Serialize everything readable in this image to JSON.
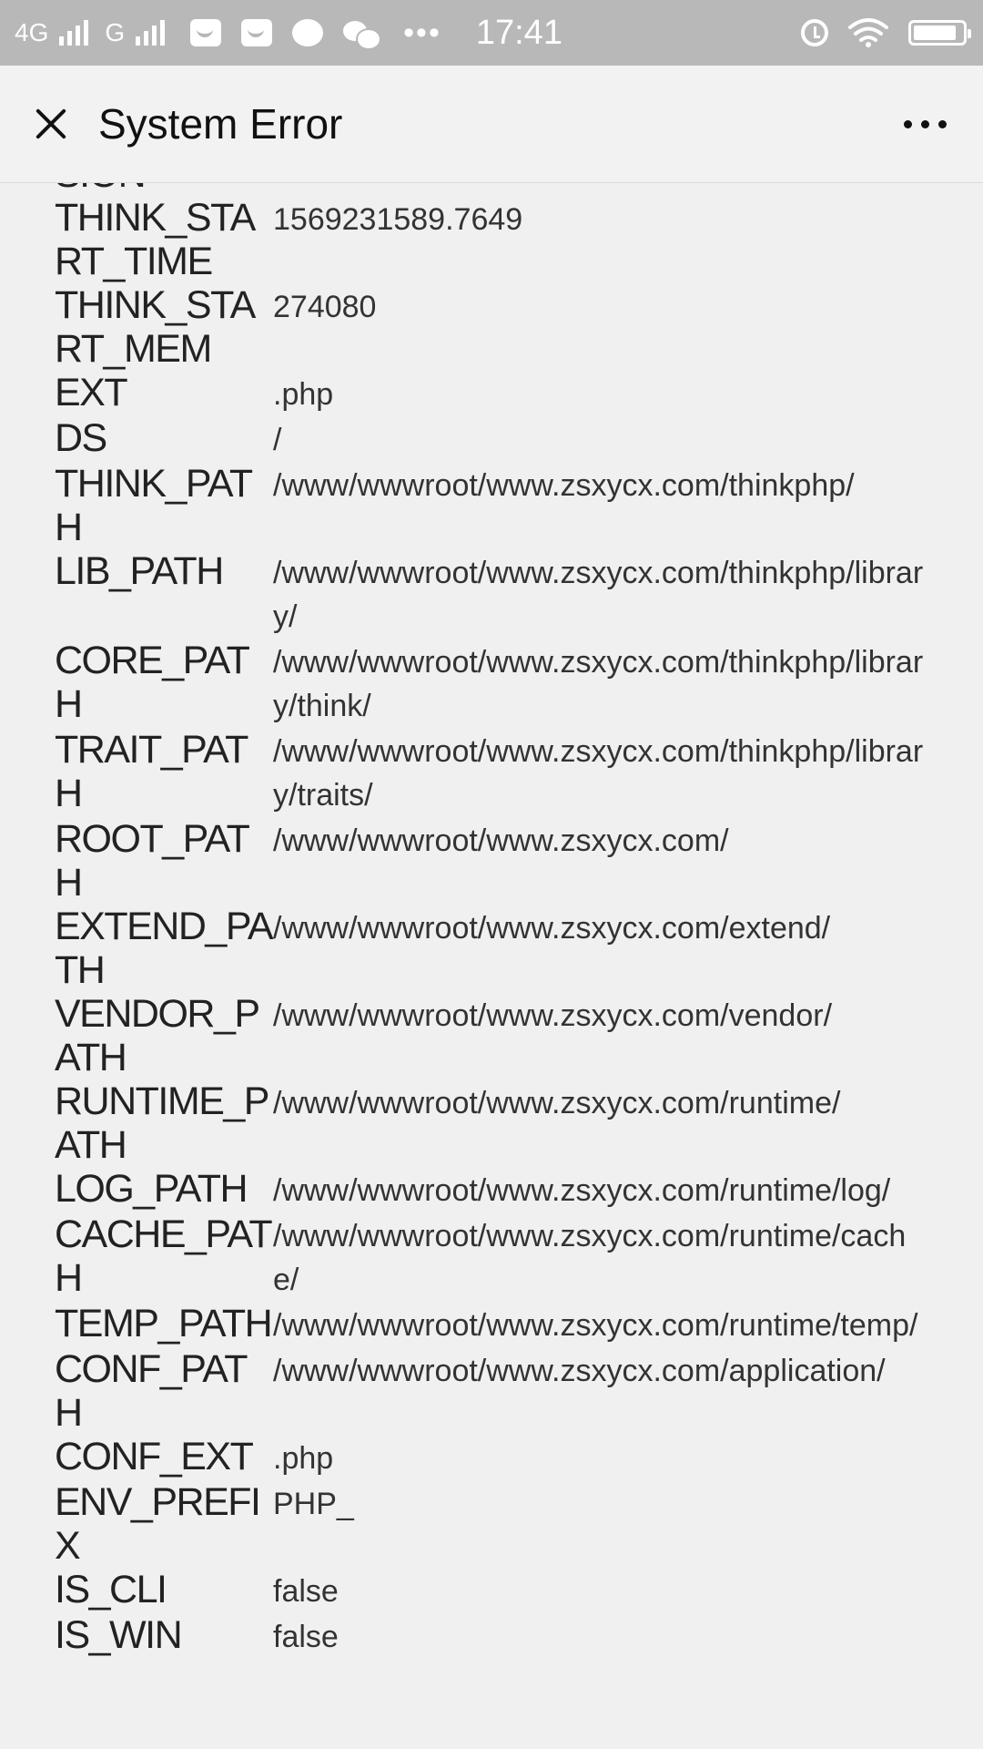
{
  "status_bar": {
    "network_left": "4G",
    "network_right": "G",
    "time": "17:41",
    "icons": [
      "mail-icon",
      "mail-icon",
      "browser-icon",
      "wechat-icon",
      "more-notifications-icon",
      "alarm-icon",
      "wifi-icon",
      "battery-icon"
    ],
    "battery_level": 0.9,
    "background_color": "#b8b8b8"
  },
  "header": {
    "title": "System Error",
    "close_icon": "close-icon",
    "more_icon": "more-icon"
  },
  "constants": [
    {
      "key": "SION",
      "value": ""
    },
    {
      "key": "THINK_START_TIME",
      "value": "1569231589.7649"
    },
    {
      "key": "THINK_START_MEM",
      "value": "274080"
    },
    {
      "key": "EXT",
      "value": ".php"
    },
    {
      "key": "DS",
      "value": "/"
    },
    {
      "key": "THINK_PATH",
      "value": "/www/wwwroot/www.zsxycx.com/thinkphp/"
    },
    {
      "key": "LIB_PATH",
      "value": "/www/wwwroot/www.zsxycx.com/thinkphp/library/"
    },
    {
      "key": "CORE_PATH",
      "value": "/www/wwwroot/www.zsxycx.com/thinkphp/library/think/"
    },
    {
      "key": "TRAIT_PATH",
      "value": "/www/wwwroot/www.zsxycx.com/thinkphp/library/traits/"
    },
    {
      "key": "ROOT_PATH",
      "value": "/www/wwwroot/www.zsxycx.com/"
    },
    {
      "key": "EXTEND_PATH",
      "value": "/www/wwwroot/www.zsxycx.com/extend/"
    },
    {
      "key": "VENDOR_PATH",
      "value": "/www/wwwroot/www.zsxycx.com/vendor/"
    },
    {
      "key": "RUNTIME_PATH",
      "value": "/www/wwwroot/www.zsxycx.com/runtime/"
    },
    {
      "key": "LOG_PATH",
      "value": "/www/wwwroot/www.zsxycx.com/runtime/log/"
    },
    {
      "key": "CACHE_PATH",
      "value": "/www/wwwroot/www.zsxycx.com/runtime/cache/"
    },
    {
      "key": "TEMP_PATH",
      "value": "/www/wwwroot/www.zsxycx.com/runtime/temp/"
    },
    {
      "key": "CONF_PATH",
      "value": "/www/wwwroot/www.zsxycx.com/application/"
    },
    {
      "key": "CONF_EXT",
      "value": ".php"
    },
    {
      "key": "ENV_PREFIX",
      "value": "PHP_"
    },
    {
      "key": "IS_CLI",
      "value": "false"
    },
    {
      "key": "IS_WIN",
      "value": "false"
    }
  ]
}
